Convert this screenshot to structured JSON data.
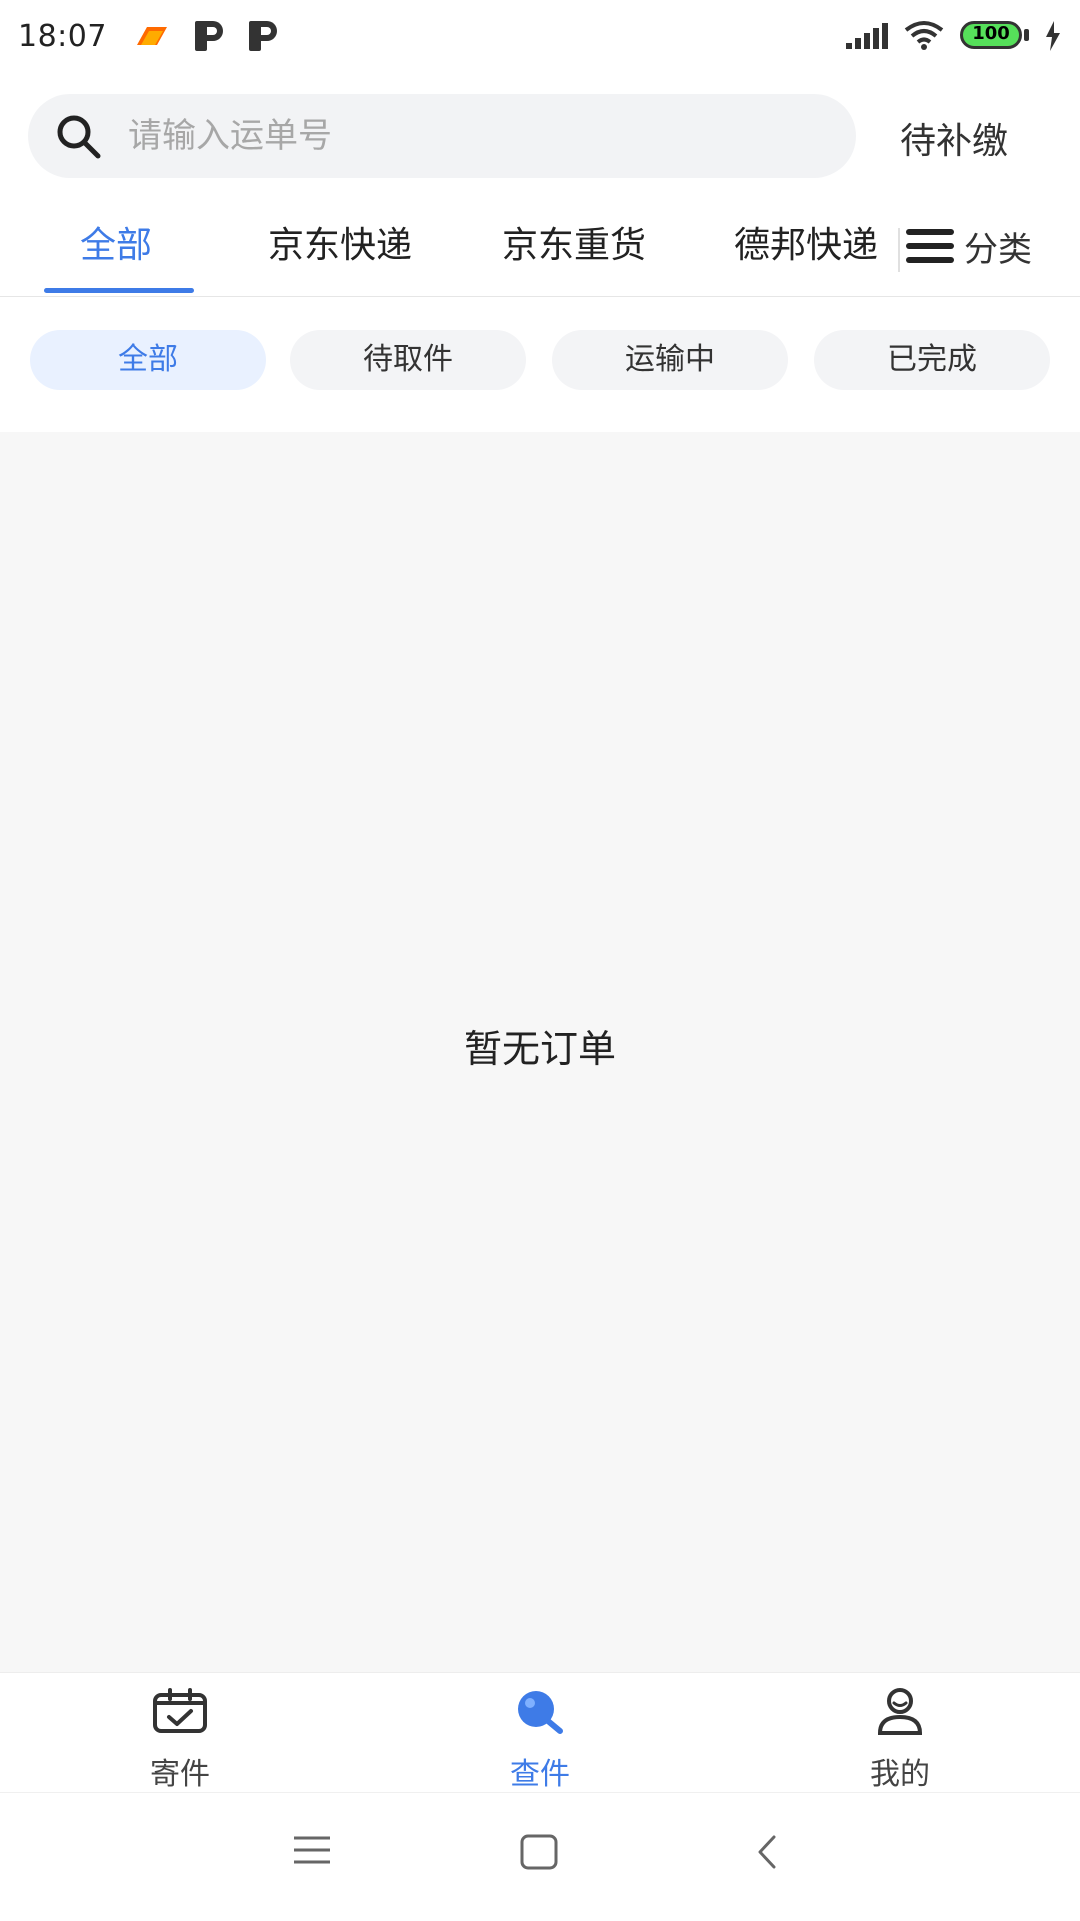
{
  "status_bar": {
    "time": "18:07",
    "battery": "100"
  },
  "search": {
    "placeholder": "请输入运单号",
    "pending_pay_label": "待补缴"
  },
  "tabs": [
    {
      "label": "全部"
    },
    {
      "label": "京东快递"
    },
    {
      "label": "京东重货"
    },
    {
      "label": "德邦快递"
    }
  ],
  "category": {
    "label": "分类"
  },
  "filters": [
    {
      "label": "全部"
    },
    {
      "label": "待取件"
    },
    {
      "label": "运输中"
    },
    {
      "label": "已完成"
    }
  ],
  "content": {
    "empty_text": "暂无订单"
  },
  "bottom_nav": [
    {
      "label": "寄件"
    },
    {
      "label": "查件"
    },
    {
      "label": "我的"
    }
  ],
  "colors": {
    "accent": "#3e7be7",
    "chip_active_bg": "#e9f1ff",
    "content_bg": "#f7f7f7"
  },
  "icons": {
    "search": "search-icon",
    "category": "menu-lines-icon",
    "send": "package-check-icon",
    "track": "track-search-icon",
    "profile": "user-icon",
    "sys_menu": "menu-icon",
    "sys_home": "square-icon",
    "sys_back": "back-chevron-icon"
  }
}
